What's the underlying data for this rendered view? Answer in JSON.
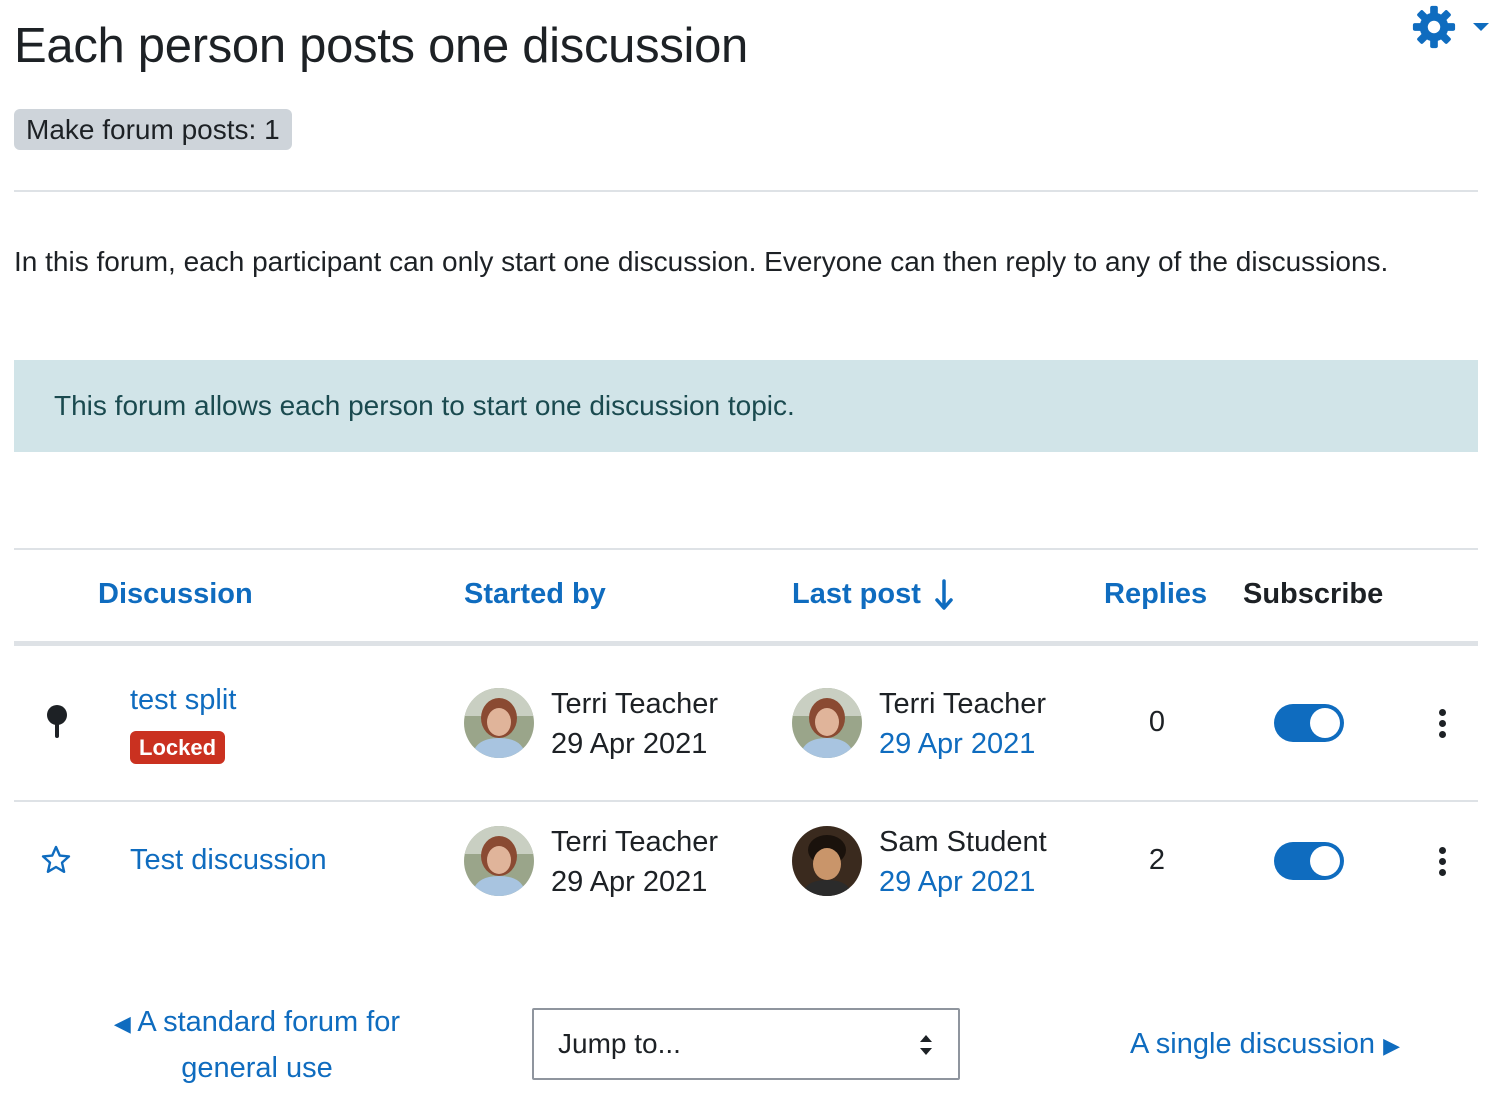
{
  "page": {
    "title": "Each person posts one discussion",
    "completion_badge": "Make forum posts: 1",
    "intro": "In this forum, each participant can only start one discussion. Everyone can then reply to any of the discussions.",
    "alert": "This forum allows each person to start one discussion topic."
  },
  "actions_menu": {
    "icon": "gear-icon"
  },
  "table": {
    "headers": {
      "discussion": "Discussion",
      "started_by": "Started by",
      "last_post": "Last post",
      "replies": "Replies",
      "subscribe": "Subscribe"
    },
    "sort": {
      "column": "last_post",
      "direction": "descending",
      "icon": "arrow-down-icon"
    },
    "rows": [
      {
        "icon": "pin-icon",
        "title": "test split",
        "badge": "Locked",
        "started_by": {
          "name": "Terri Teacher",
          "date": "29 Apr 2021",
          "avatar": "teacher"
        },
        "last_post": {
          "name": "Terri Teacher",
          "date": "29 Apr 2021",
          "avatar": "teacher"
        },
        "replies": "0",
        "subscribed": true
      },
      {
        "icon": "star-outline-icon",
        "title": "Test discussion",
        "badge": "",
        "started_by": {
          "name": "Terri Teacher",
          "date": "29 Apr 2021",
          "avatar": "teacher"
        },
        "last_post": {
          "name": "Sam Student",
          "date": "29 Apr 2021",
          "avatar": "student"
        },
        "replies": "2",
        "subscribed": true
      }
    ]
  },
  "navigation": {
    "prev": "A standard forum for general use",
    "jump": "Jump to...",
    "next": "A single discussion"
  },
  "colors": {
    "link": "#0f6cbf",
    "text": "#1d2125",
    "alert_bg": "#d1e4e8",
    "alert_text": "#1a4a4f",
    "locked_bg": "#ca3120",
    "badge_bg": "#ced4da",
    "toggle_on": "#0f6cbf"
  }
}
